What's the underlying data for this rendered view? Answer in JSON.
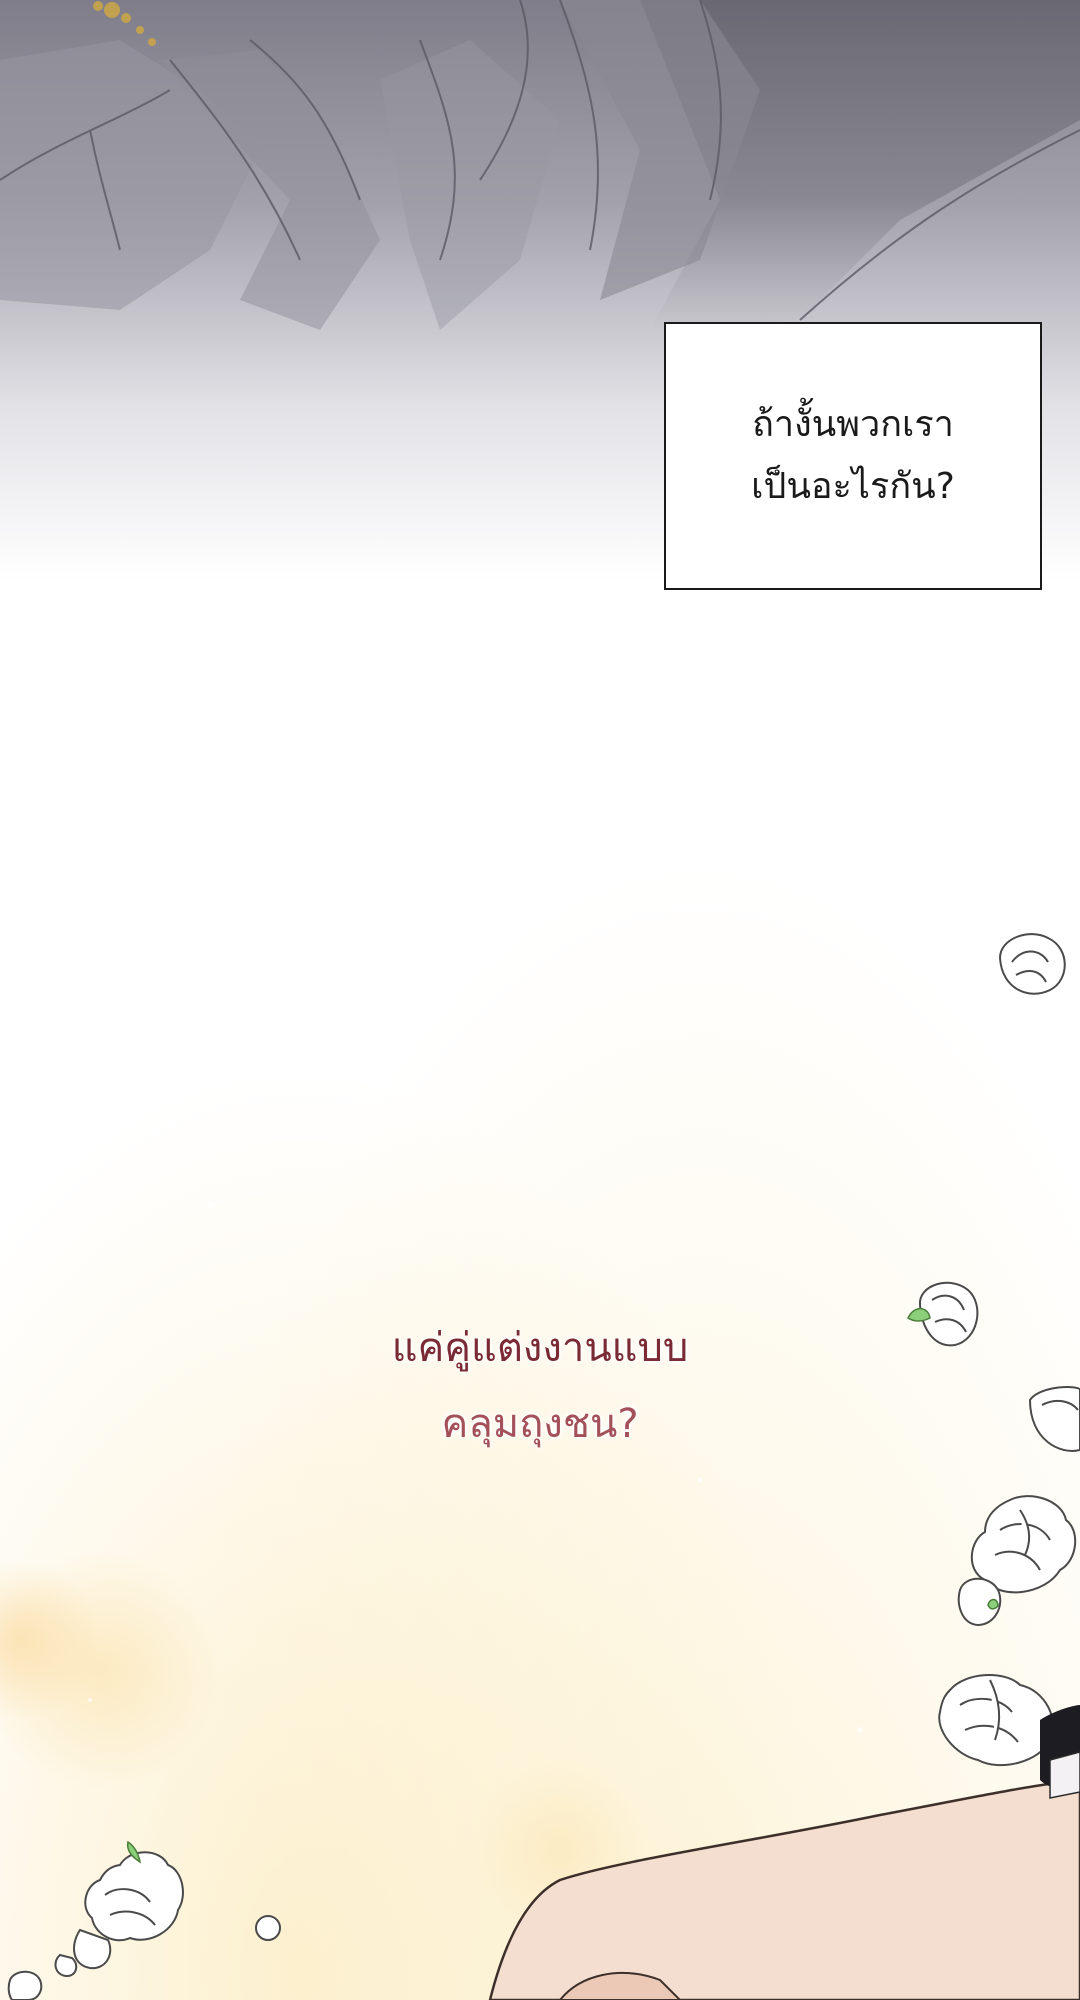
{
  "narration": {
    "lines": [
      "ถ้างั้นพวกเรา",
      "เป็นอะไรกัน?"
    ]
  },
  "dialogue": {
    "lines": [
      "แค่คู่แต่งงานแบบ",
      "คลุมถุงชน?"
    ],
    "colors": [
      "#7a2a34",
      "#a4505a"
    ]
  },
  "colors": {
    "art_grey": "#8e8c96",
    "glow_warm": "#f7d9a0",
    "box_border": "#1a1a1a"
  }
}
